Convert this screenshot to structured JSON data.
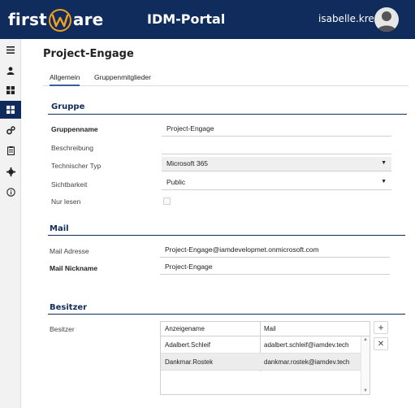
{
  "header": {
    "logo_left": "first",
    "logo_right": "are",
    "app_title": "IDM-Portal",
    "username": "isabelle.kress"
  },
  "sidebar": {
    "items": [
      {
        "icon": "menu-icon"
      },
      {
        "icon": "user-icon"
      },
      {
        "icon": "dashboard-icon"
      },
      {
        "icon": "groups-icon",
        "active": true
      },
      {
        "icon": "roles-icon"
      },
      {
        "icon": "clipboard-icon"
      },
      {
        "icon": "settings-icon"
      },
      {
        "icon": "info-icon"
      }
    ]
  },
  "page": {
    "title": "Project-Engage"
  },
  "tabs": [
    {
      "label": "Allgemein",
      "active": true
    },
    {
      "label": "Gruppenmitglieder",
      "active": false
    }
  ],
  "gruppe": {
    "section_title": "Gruppe",
    "gruppenname_label": "Gruppenname",
    "gruppenname_value": "Project-Engage",
    "beschreibung_label": "Beschreibung",
    "beschreibung_value": "",
    "typ_label": "Technischer Typ",
    "typ_value": "Microsoft 365",
    "sichtbarkeit_label": "Sichtbarkeit",
    "sichtbarkeit_value": "Public",
    "nurlesen_label": "Nur lesen",
    "nurlesen_checked": false
  },
  "mail": {
    "section_title": "Mail",
    "adresse_label": "Mail Adresse",
    "adresse_value": "Project-Engage@iamdevelopmet.onmicrosoft.com",
    "nickname_label": "Mail Nickname",
    "nickname_value": "Project-Engage"
  },
  "besitzer": {
    "section_title": "Besitzer",
    "field_label": "Besitzer",
    "columns": [
      "Anzeigename",
      "Mail"
    ],
    "rows": [
      {
        "name": "Adalbert.Schleif",
        "mail": "adalbert.schleif@iamdev.tech"
      },
      {
        "name": "Dankmar.Rostek",
        "mail": "dankmar.rostek@iamdev.tech"
      }
    ],
    "add_label": "+",
    "remove_label": "✕"
  },
  "colors": {
    "primary": "#102c5c",
    "accent": "#3a5da0",
    "logo_accent": "#f0a020"
  }
}
